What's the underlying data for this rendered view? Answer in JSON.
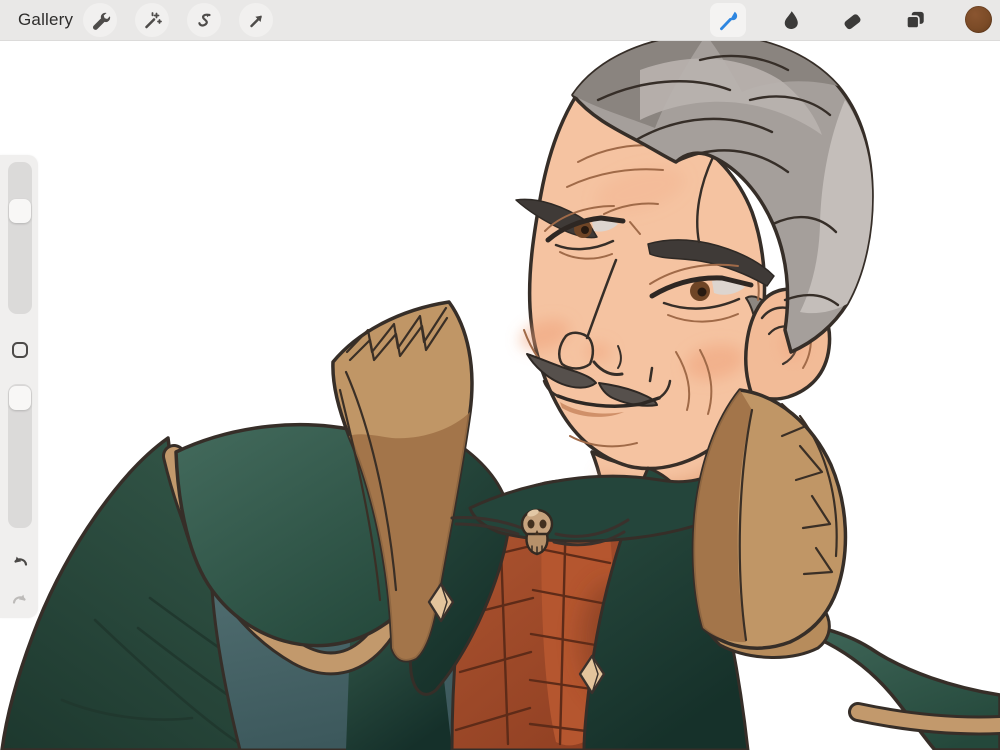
{
  "top_bar": {
    "gallery_label": "Gallery",
    "left_tools": [
      {
        "name": "Actions",
        "icon": "wrench-icon"
      },
      {
        "name": "Adjustments",
        "icon": "magic-wand-icon"
      },
      {
        "name": "Selection",
        "icon": "selection-s-icon"
      },
      {
        "name": "Transform",
        "icon": "transform-arrow-icon"
      }
    ],
    "right_tools": [
      {
        "name": "Paint",
        "icon": "paintbrush-icon",
        "selected": true
      },
      {
        "name": "Smudge",
        "icon": "smudge-icon",
        "selected": false
      },
      {
        "name": "Erase",
        "icon": "eraser-icon",
        "selected": false
      },
      {
        "name": "Layers",
        "icon": "layers-icon",
        "selected": false
      },
      {
        "name": "Color",
        "icon": "color-swatch",
        "selected": false
      }
    ],
    "selected_tool": "Paint",
    "bar_background": "#e9e8e7",
    "accent_blue": "#2e86e0",
    "current_color": "#7b4b27"
  },
  "sidebar": {
    "brush_size_slider": {
      "handle_fraction": 0.24
    },
    "opacity_slider": {
      "handle_fraction": 0.02
    },
    "modify_button": "square-outline-icon",
    "undo_icon": "undo-arrow-icon",
    "redo_icon": "redo-arrow-icon"
  },
  "canvas": {
    "background": "#ffffff",
    "artwork": {
      "subject": "Digital portrait of an older gentleman with swept-back gray hair, smirking, wearing a dark green coat with tall tan collar, rust herringbone cravat-vest, skull pin and diamond studs",
      "palette": {
        "line": "#362e28",
        "skin": "#f5c3a1",
        "blush": "#ef9f78",
        "hair_gray": "#a59f9b",
        "hair_dark": "#8a847f",
        "hair_light": "#c4beba",
        "coat_green": "#35594a",
        "coat_green_dark": "#1f3d32",
        "lapel_green": "#24453b",
        "teal_under": "#4e6a6d",
        "collar_tan": "#c09666",
        "collar_tan_dark": "#9d7045",
        "vest_rust": "#a8502d",
        "vest_shadow": "#7c3a20",
        "gold_stud": "#e3c49c",
        "skull_bone": "#c6a37e"
      }
    }
  }
}
